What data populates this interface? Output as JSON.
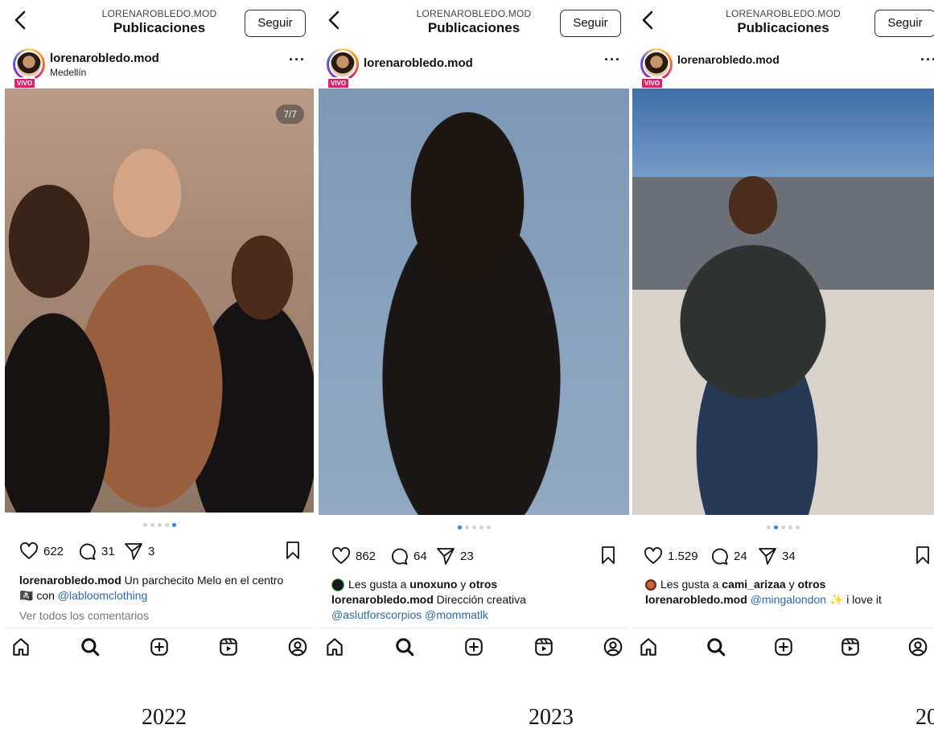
{
  "colors": {
    "accent": "#1c8de8",
    "live": "#d6246e",
    "link": "#2a6ab0"
  },
  "header": {
    "title": "Publicaciones",
    "follow_label": "Seguir"
  },
  "posts": [
    {
      "header_user": "LORENAROBLEDO.MOD",
      "username": "lorenarobledo.mod",
      "location": "Medellín",
      "live_badge": "VIVO",
      "image_counter": "7/7",
      "carousel": {
        "count": 5,
        "active": 4
      },
      "likes": "622",
      "comments": "31",
      "shares": "3",
      "caption_user": "lorenarobledo.mod",
      "caption_text": " Un parchecito Melo en el centro",
      "caption_line2_icon": "🏴‍☠️",
      "caption_line2_text": " con ",
      "caption_mention": "@labloomclothing",
      "view_comments": "Ver todos los comentarios",
      "year": "2022"
    },
    {
      "header_user": "LORENAROBLEDO.MOD",
      "username": "lorenarobledo.mod",
      "live_badge": "VIVO",
      "carousel": {
        "count": 5,
        "active": 0
      },
      "likes": "862",
      "comments": "64",
      "shares": "23",
      "liked_by_prefix": "Les gusta a ",
      "liked_by_user": "unoxuno",
      "liked_by_join": " y ",
      "liked_by_others": "otros",
      "caption_user": "lorenarobledo.mod",
      "caption_text": " Dirección creativa",
      "caption_mentions": "@aslutforscorpios @mommatlk",
      "year": "2023"
    },
    {
      "header_user": "LORENAROBLEDO.MOD",
      "username": "lorenarobledo.mod",
      "live_badge": "VIVO",
      "carousel": {
        "count": 5,
        "active": 1
      },
      "likes": "1.529",
      "comments": "24",
      "shares": "34",
      "liked_by_prefix": "Les gusta a ",
      "liked_by_user": "cami_arizaa",
      "liked_by_join": " y ",
      "liked_by_others": "otros",
      "caption_user": "lorenarobledo.mod",
      "caption_mention": "@mingalondon",
      "caption_emoji": "✨",
      "caption_text": " i love it",
      "year": "20"
    }
  ],
  "nav_icons": [
    "home-icon",
    "search-icon",
    "create-icon",
    "reels-icon",
    "profile-icon"
  ]
}
